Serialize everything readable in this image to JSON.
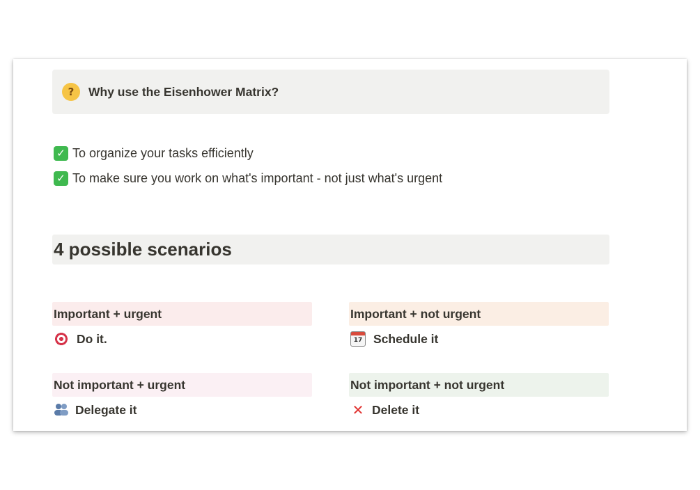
{
  "callout": {
    "icon": "thinking-face-emoji",
    "icon_glyph": "?",
    "text": "Why use the Eisenhower Matrix?"
  },
  "reasons": [
    {
      "icon": "check-mark-emoji",
      "text": "To organize your tasks efficiently"
    },
    {
      "icon": "check-mark-emoji",
      "text": "To make sure you work on what's important - not just what's urgent"
    }
  ],
  "heading": "4 possible scenarios",
  "quadrants": [
    {
      "label": "Important + urgent",
      "label_bg": "#fbecec",
      "action_icon": "target-icon",
      "action": "Do it."
    },
    {
      "label": "Important + not urgent",
      "label_bg": "#fbeee4",
      "action_icon": "calendar-icon",
      "action_icon_text": "17",
      "action": "Schedule it"
    },
    {
      "label": "Not important + urgent",
      "label_bg": "#fbf0f4",
      "action_icon": "people-icon",
      "action": "Delegate it"
    },
    {
      "label": "Not important + not urgent",
      "label_bg": "#edf3ec",
      "action_icon": "x-icon",
      "action": "Delete it"
    }
  ],
  "colors": {
    "check_green": "#3fb94f",
    "callout_bg": "#f1f1ef",
    "text": "#37352f"
  }
}
